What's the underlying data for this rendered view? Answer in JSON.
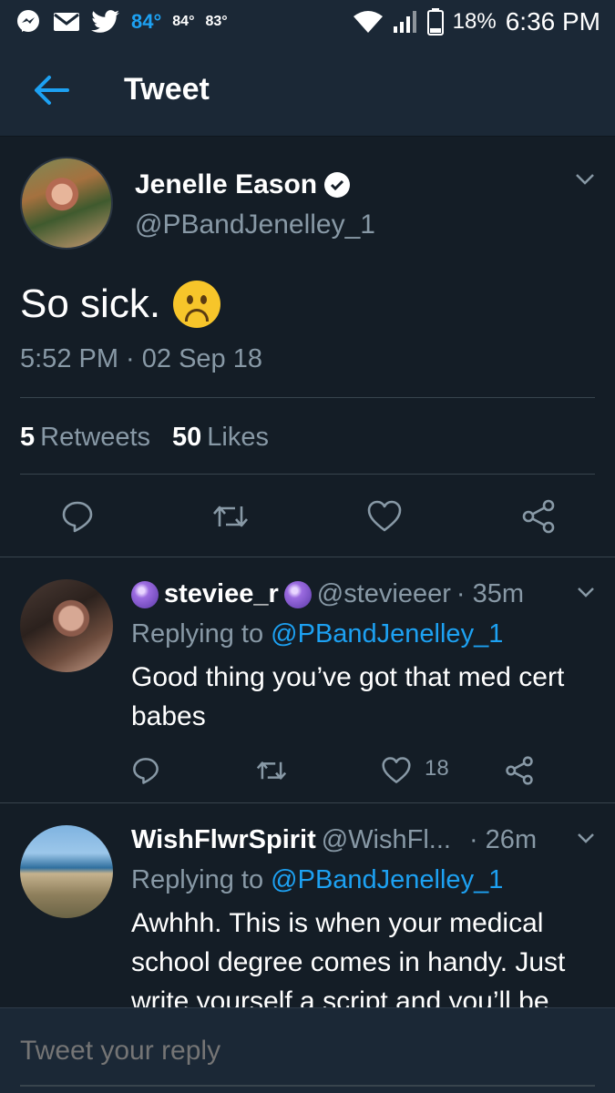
{
  "status_bar": {
    "temp_current": "84°",
    "temp_high": "84°",
    "temp_low": "83°",
    "battery": "18%",
    "time": "6:36 PM",
    "icons": [
      "messenger-icon",
      "mail-icon",
      "twitter-bird-icon",
      "wifi-icon",
      "signal-icon",
      "battery-icon"
    ]
  },
  "header": {
    "title": "Tweet",
    "back_icon": "arrow-left-icon"
  },
  "tweet": {
    "author_name": "Jenelle Eason",
    "author_handle": "@PBandJenelley_1",
    "verified": true,
    "text": "So sick.",
    "emoji": "sad-face-icon",
    "timestamp": "5:52 PM · 02 Sep 18",
    "retweets_count": "5",
    "retweets_label": "Retweets",
    "likes_count": "50",
    "likes_label": "Likes"
  },
  "replies": [
    {
      "name": "steviee_r",
      "handle": "@stevieeer",
      "time": "· 35m",
      "replying_prefix": "Replying to",
      "replying_to": "@PBandJenelley_1",
      "text": "Good thing you’ve got that med cert babes",
      "likes": "18"
    },
    {
      "name": "WishFlwrSpirit",
      "handle": "@WishFl...",
      "time": "· 26m",
      "replying_prefix": "Replying to",
      "replying_to": "@PBandJenelley_1",
      "text": "Awhhh.  This is when your medical school degree comes in handy. Just write yourself a script and you’ll be"
    }
  ],
  "composer": {
    "placeholder": "Tweet your reply"
  },
  "colors": {
    "background": "#141d26",
    "bar": "#1b2836",
    "accent": "#1da1f2",
    "muted": "#8899a6"
  }
}
